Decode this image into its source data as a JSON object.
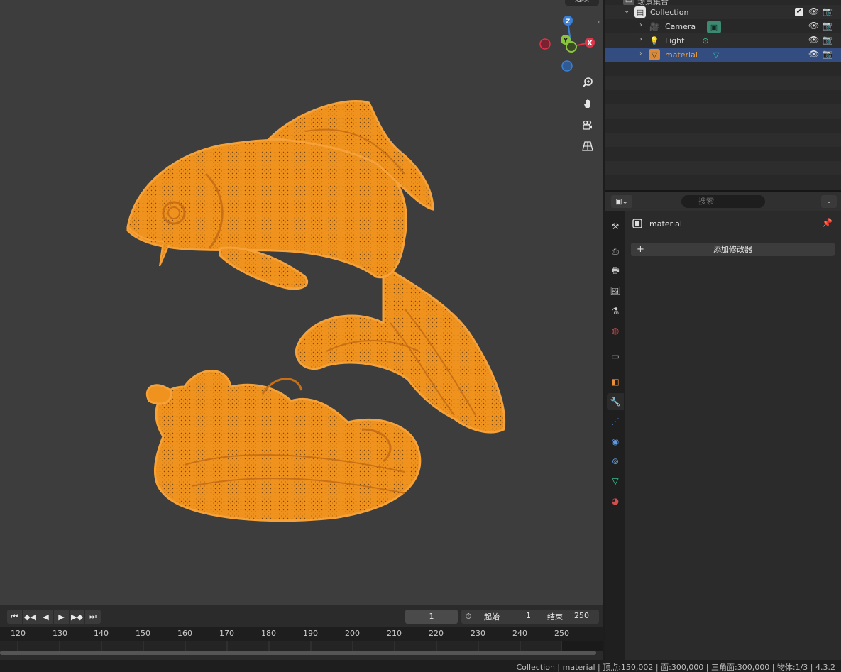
{
  "viewport": {
    "header_dropdown": "选项",
    "gizmo": {
      "z": "Z",
      "y": "Y",
      "x": "X"
    },
    "nav_buttons": [
      "zoom-icon",
      "hand-pan-icon",
      "camera-view-icon",
      "grid-ortho-icon"
    ],
    "mesh_color": "#f0921e"
  },
  "timeline": {
    "current_frame": "1",
    "start_label": "起始",
    "start_value": "1",
    "end_label": "结束",
    "end_value": "250",
    "ticks": [
      "120",
      "130",
      "140",
      "150",
      "160",
      "170",
      "180",
      "190",
      "200",
      "210",
      "220",
      "230",
      "240",
      "250"
    ]
  },
  "outliner": {
    "title": "场景集合",
    "collection": "Collection",
    "items": [
      {
        "label": "Camera",
        "icon": "camera-icon"
      },
      {
        "label": "Light",
        "icon": "light-icon"
      },
      {
        "label": "material",
        "icon": "mesh-icon",
        "selected": true
      }
    ]
  },
  "properties": {
    "search_placeholder": "搜索",
    "object_name": "material",
    "add_modifier_label": "添加修改器",
    "tabs": [
      "tool-icon",
      "render-icon",
      "output-icon",
      "view-layer-icon",
      "scene-icon",
      "world-icon",
      "collection-icon",
      "object-icon",
      "modifier-icon",
      "particles-icon",
      "physics-icon",
      "constraints-icon",
      "data-icon",
      "material-icon"
    ],
    "active_tab": "modifier-icon"
  },
  "statusbar": {
    "text": "Collection | material | 顶点:150,002 | 面:300,000 | 三角面:300,000 | 物体:1/3 | 4.3.2"
  },
  "colors": {
    "accent_selected": "#334d80",
    "axis_x": "#e0344a",
    "axis_y": "#8bc53f",
    "axis_z": "#3b80d6"
  }
}
